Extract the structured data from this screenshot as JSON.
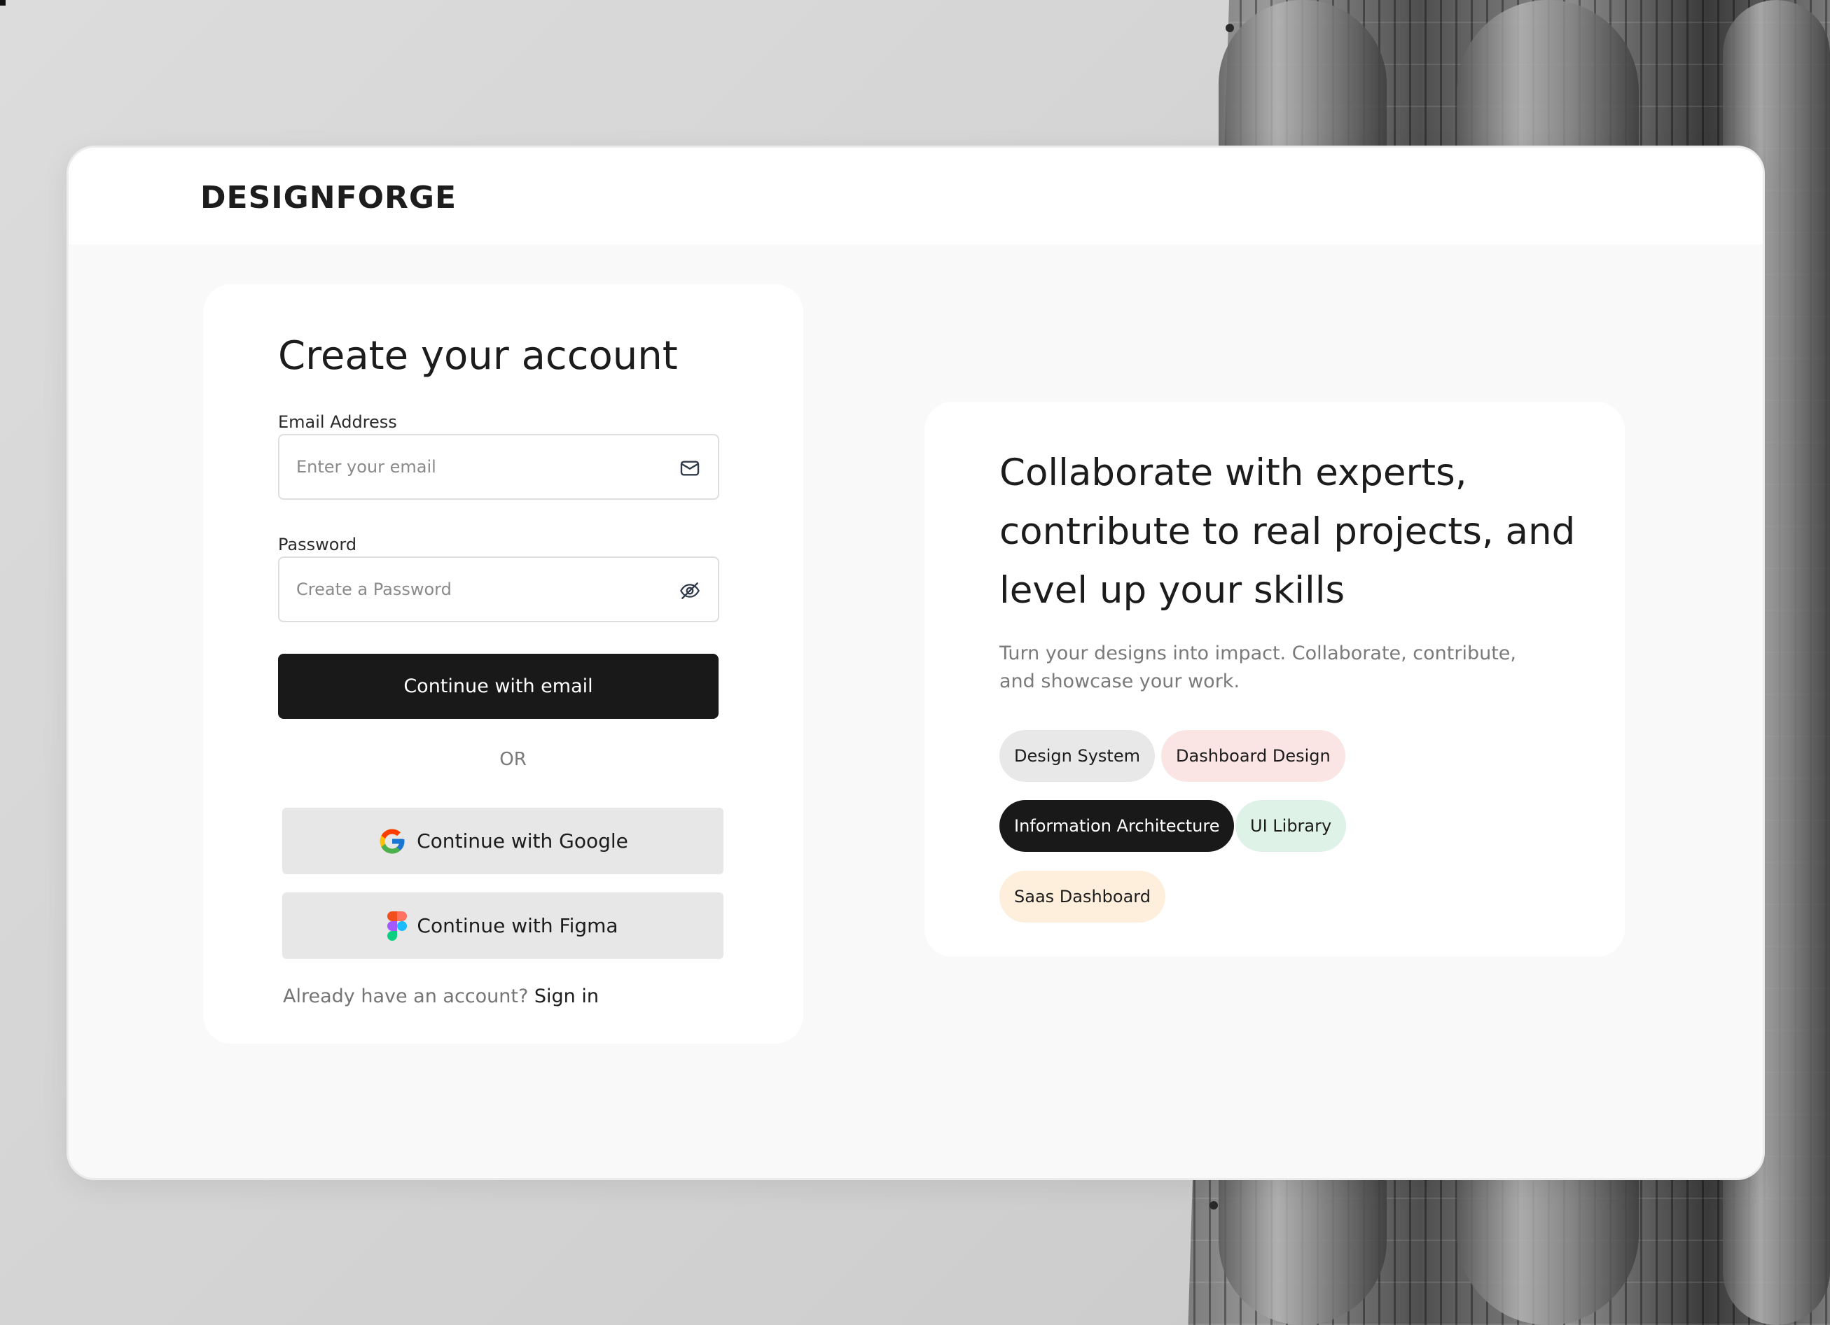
{
  "brand": {
    "logo_text": "DESIGNFORGE"
  },
  "form": {
    "title": "Create your account",
    "email": {
      "label": "Email Address",
      "placeholder": "Enter your email",
      "icon": "mail-icon"
    },
    "password": {
      "label": "Password",
      "placeholder": "Create a Password",
      "icon": "eye-off-icon"
    },
    "primary_button": "Continue  with email",
    "divider_text": "OR",
    "google_button": "Continue with Google",
    "figma_button": "Continue with Figma",
    "signin_prompt": "Already have an account?",
    "signin_link": "Sign in"
  },
  "info": {
    "headline": "Collaborate with experts, contribute to real projects, and level up your skills",
    "subtext": "Turn your designs into impact. Collaborate, contribute, and showcase your work.",
    "tags": [
      {
        "label": "Design System",
        "bg": "#e8e8e8",
        "fg": "#1c1c1c"
      },
      {
        "label": "Dashboard Design",
        "bg": "#fbe4e4",
        "fg": "#1c1c1c"
      },
      {
        "label": "Information Architecture",
        "bg": "#191919",
        "fg": "#ffffff"
      },
      {
        "label": "UI Library",
        "bg": "#dff2e7",
        "fg": "#1c1c1c"
      },
      {
        "label": "Saas Dashboard",
        "bg": "#fdefdc",
        "fg": "#1c1c1c"
      }
    ]
  },
  "colors": {
    "primary": "#191919",
    "card": "#ffffff",
    "page": "#f9f9f9"
  }
}
